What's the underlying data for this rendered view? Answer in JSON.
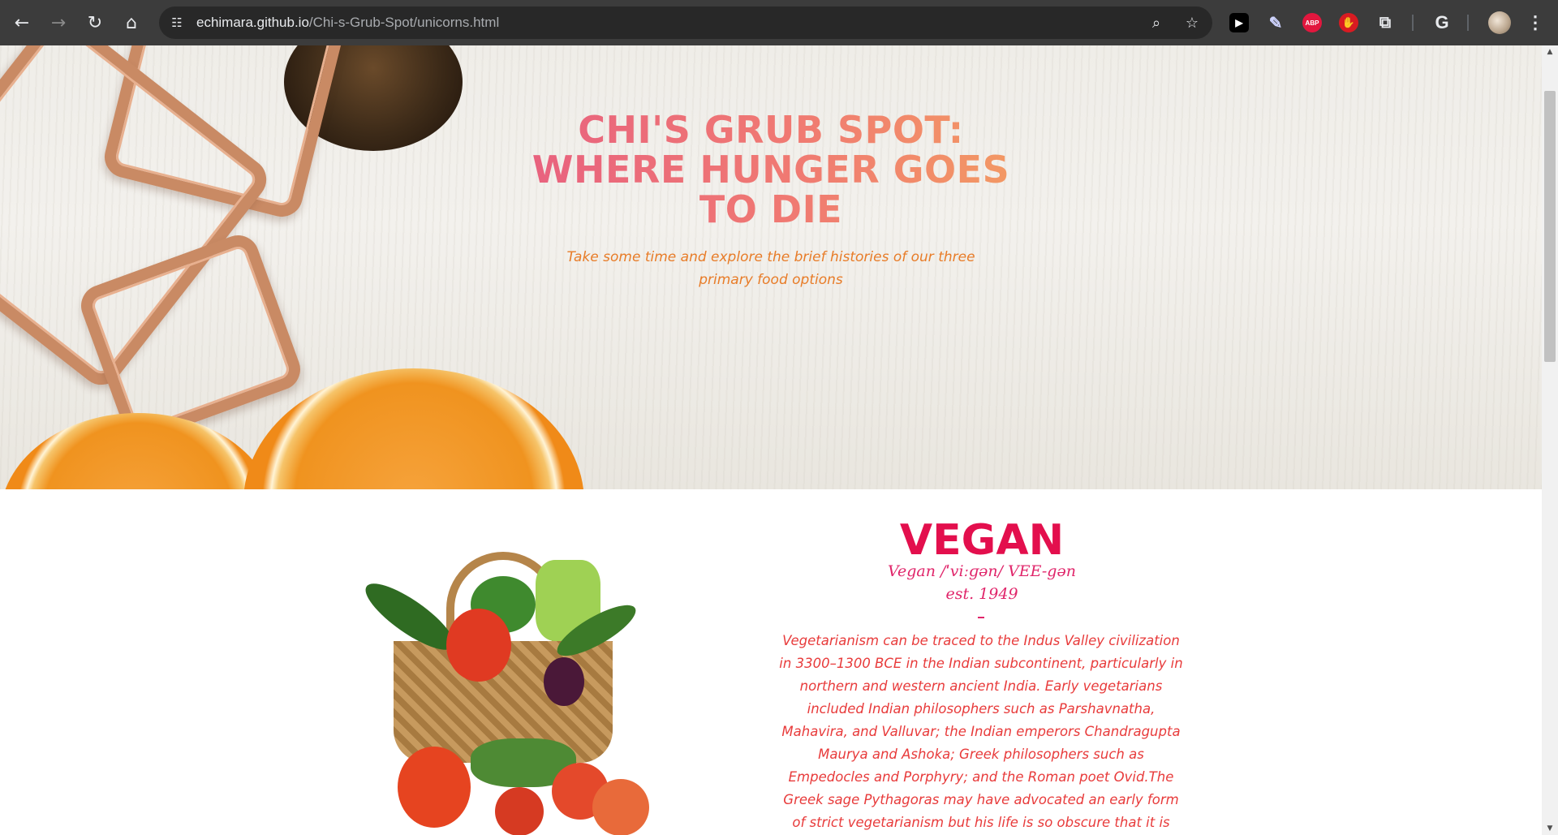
{
  "browser": {
    "url_host": "echimara.github.io",
    "url_path": "/Chi-s-Grub-Spot/unicorns.html",
    "icons": {
      "back": "arrow-left",
      "forward": "arrow-right",
      "reload": "reload",
      "home": "home",
      "site_info": "tune",
      "zoom": "magnifier",
      "bookmark": "star",
      "extensions": [
        "play",
        "eyedropper",
        "adblock-plus",
        "hand-stop",
        "puzzle",
        "google"
      ],
      "menu": "three-dots"
    },
    "ext_labels": {
      "play": "▶",
      "abp": "ABP"
    }
  },
  "hero": {
    "title": "CHI'S GRUB SPOT: WHERE HUNGER GOES TO DIE",
    "subtitle": "Take some time and explore the brief histories of our three primary food options"
  },
  "section": {
    "title": "VEGAN",
    "pronunciation": "Vegan /ˈviːɡən/ VEE-gən",
    "established": "est. 1949",
    "divider": "-",
    "body": "Vegetarianism can be traced to the Indus Valley civilization in 3300–1300 BCE in the Indian subcontinent, particularly in northern and western ancient India. Early vegetarians included Indian philosophers such as Parshavnatha, Mahavira, and Valluvar; the Indian emperors Chandragupta Maurya and Ashoka; Greek philosophers such as Empedocles and Porphyry; and the Roman poet Ovid.The Greek sage Pythagoras may have advocated an early form of strict vegetarianism but his life is so obscure that it is disputed whether he ever advocated any form"
  },
  "colors": {
    "chrome_bg": "#3c3c3c",
    "title_pink": "#e8617f",
    "title_orange": "#f39a63",
    "subtitle_orange": "#e87c28",
    "section_title": "#e30f4d",
    "pron_pink": "#e0256a",
    "body_red": "#e83b3b"
  }
}
